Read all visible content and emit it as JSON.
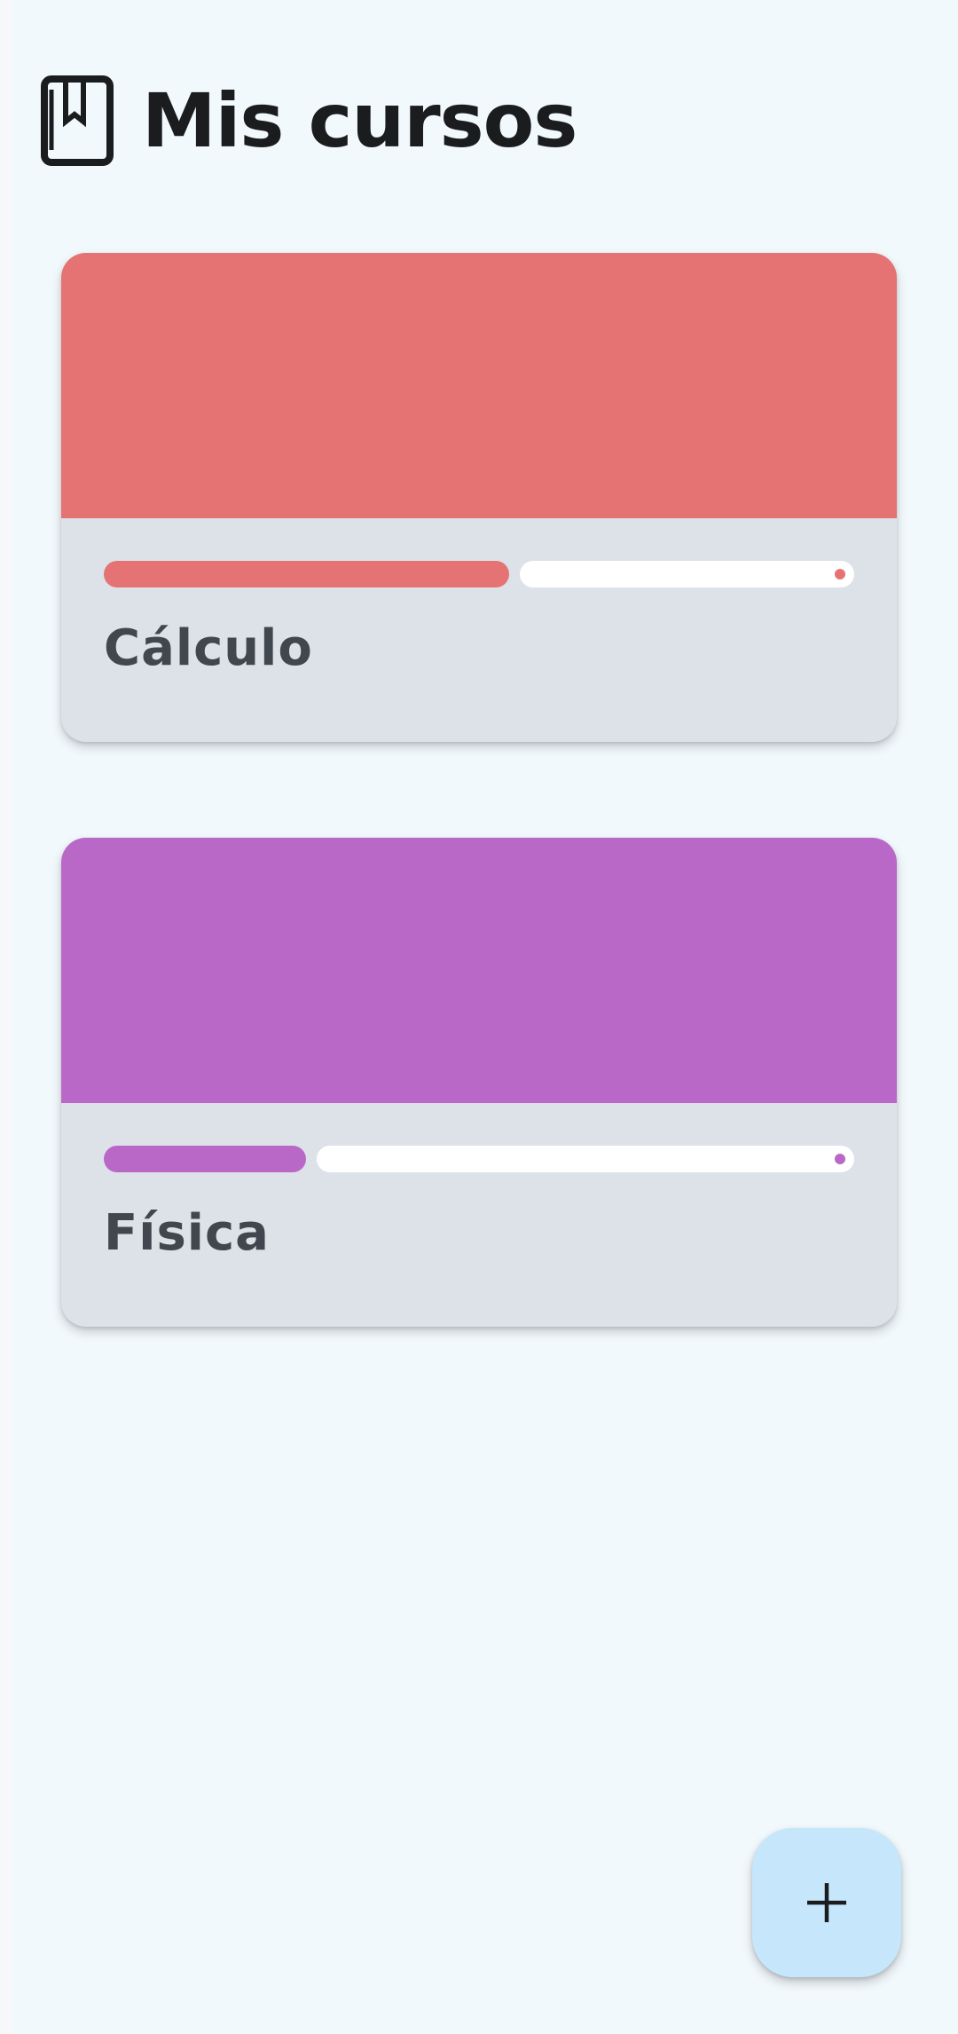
{
  "header": {
    "title": "Mis cursos",
    "icon": "bookmark-book-icon"
  },
  "courses": [
    {
      "name": "Cálculo",
      "color": "#e57373",
      "progress": 0.54
    },
    {
      "name": "Física",
      "color": "#ba68c8",
      "progress": 0.27
    }
  ],
  "fab": {
    "icon": "plus-icon",
    "color": "#c5e6fb"
  }
}
